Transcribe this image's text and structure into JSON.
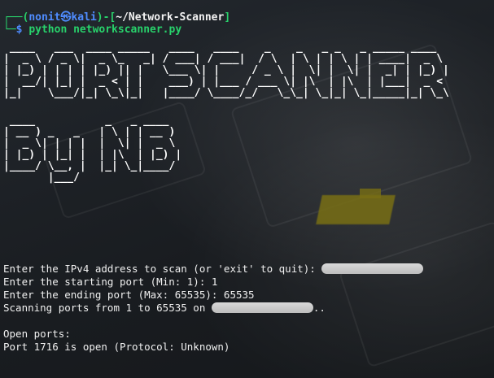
{
  "prompt": {
    "user": "nonit",
    "host": "kali",
    "cwd": "~/Network-Scanner",
    "command": "python networkscanner.py"
  },
  "banner": {
    "line1": " ____   ___  ____ _____   ____   ____    _    _   _ _   _ _____ ____  \n|  _ \\ / _ \\|  _ \\_   _| / ___| / ___|  / \\  | \\ | | \\ | | ____|  _ \\ \n| |_) | | | | |_) || |   \\___ \\| |     / _ \\ |  \\| |  \\| |  _| | |_) |\n|  __/| |_| |  _ < | |    ___) | |___ / ___ \\| |\\  | |\\  | |___|  _ < \n|_|    \\___/|_| \\_\\|_|   |____/ \\____/_/   \\_\\_| \\_|_| \\_|_____|_| \\_\\",
    "line2": " ____           _   _ ____  \n| __ ) _   _   | \\ | | __ ) \n|  _ \\| | | |  |  \\| |  _ \\ \n| |_) | |_| |  | |\\  | |_) |\n|____/ \\__, |  |_| \\_|____/ \n       |___/                "
  },
  "output": {
    "ipv4_prompt": "Enter the IPv4 address to scan (or 'exit' to quit): ",
    "start_port_prompt": "Enter the starting port (Min: 1): 1",
    "end_port_prompt": "Enter the ending port (Max: 65535): 65535",
    "scanning_prefix": "Scanning ports from 1 to 65535 on ",
    "scanning_suffix": "..",
    "open_ports_header": "Open ports:",
    "open_port_line": "Port 1716 is open (Protocol: Unknown)"
  }
}
